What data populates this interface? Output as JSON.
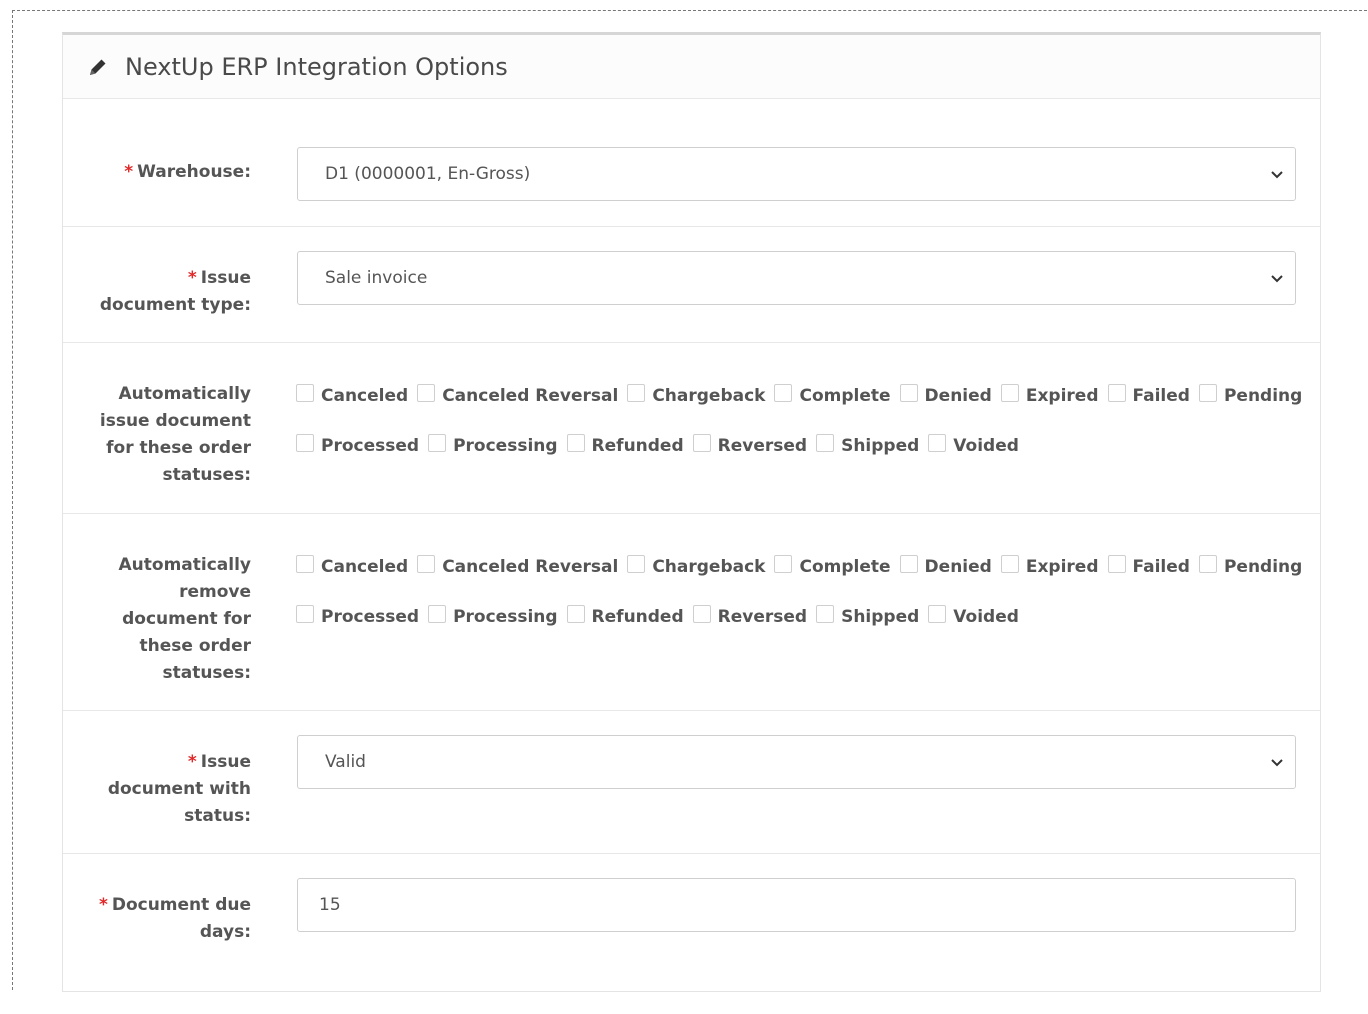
{
  "panel": {
    "title": "NextUp ERP Integration Options"
  },
  "fields": {
    "warehouse": {
      "label": "Warehouse:",
      "value": "D1 (0000001, En-Gross)"
    },
    "issue_document_type": {
      "label_line1": "Issue",
      "label_line2": "document type:",
      "value": "Sale invoice"
    },
    "auto_issue": {
      "label_lines": [
        "Automatically",
        "issue document",
        "for these order",
        "statuses:"
      ]
    },
    "auto_remove": {
      "label_lines": [
        "Automatically",
        "remove",
        "document for",
        "these order",
        "statuses:"
      ]
    },
    "issue_status": {
      "label_line1": "Issue",
      "label_line2": "document with",
      "label_line3": "status:",
      "value": "Valid"
    },
    "due_days": {
      "label_line1": "Document due",
      "label_line2": "days:",
      "value": "15"
    }
  },
  "statuses_row1": [
    "Canceled",
    "Canceled Reversal",
    "Chargeback",
    "Complete",
    "Denied",
    "Expired",
    "Failed",
    "Pending"
  ],
  "statuses_row2": [
    "Processed",
    "Processing",
    "Refunded",
    "Reversed",
    "Shipped",
    "Voided"
  ],
  "required_mark": "*",
  "colors": {
    "required": "#e02a2a",
    "label": "#555555",
    "border": "#cfcfcf"
  }
}
